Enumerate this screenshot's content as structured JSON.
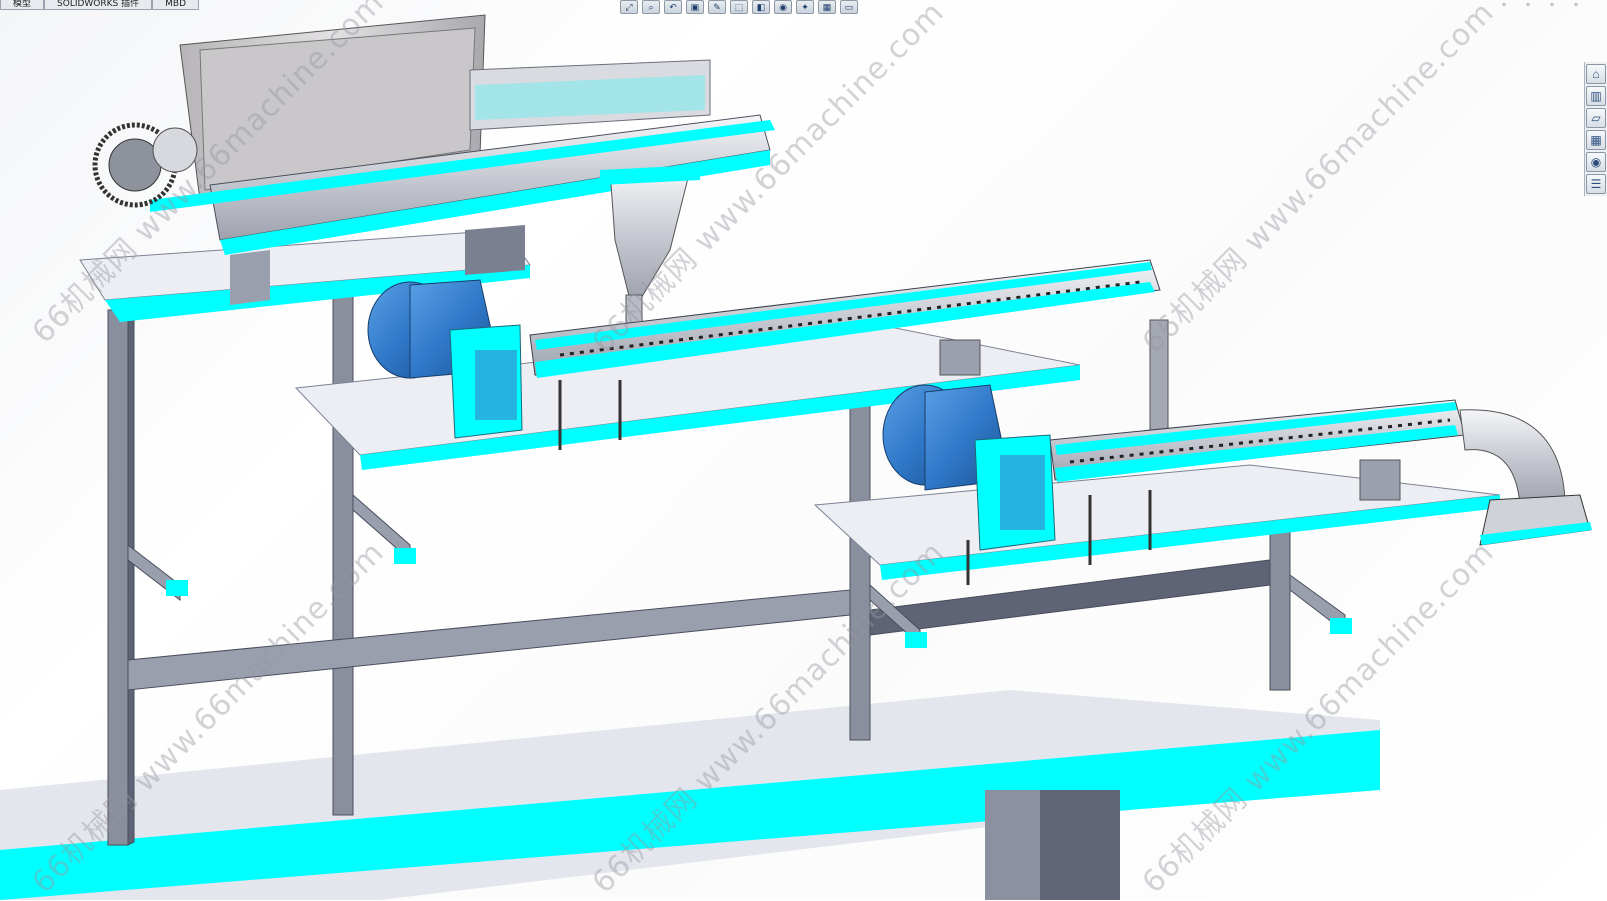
{
  "doc_tabs": [
    "模型",
    "SOLIDWORKS 插件",
    "MBD"
  ],
  "heads_up_toolbar": {
    "icons": [
      "zoom-to-fit-icon",
      "zoom-area-icon",
      "previous-view-icon",
      "section-view-icon",
      "dynamic-annotation-icon",
      "view-orientation-icon",
      "display-style-icon",
      "hide-show-icon",
      "edit-appearance-icon",
      "apply-scene-icon",
      "view-settings-icon"
    ],
    "glyphs": [
      "⤢",
      "⌕",
      "↶",
      "▣",
      "✎",
      "⬚",
      "◧",
      "◉",
      "✦",
      "▦",
      "▭"
    ]
  },
  "window_controls": {
    "icons": [
      "minimize-icon",
      "restore-icon",
      "close-icon",
      "maximize-icon"
    ],
    "glyphs": [
      "▫",
      "▫",
      "▫",
      "▫"
    ]
  },
  "task_pane": {
    "icons": [
      "home-icon",
      "3d-parts-library-icon",
      "file-explorer-icon",
      "view-palette-icon",
      "appearances-icon",
      "custom-properties-icon"
    ],
    "glyphs": [
      "⌂",
      "▥",
      "▱",
      "▦",
      "◉",
      "☰"
    ]
  },
  "watermarks": [
    "66机械网 www.66machine.com",
    "66机械网 www.66machine.com",
    "66机械网 www.66machine.com",
    "66机械网 www.66machine.com",
    "66机械网 www.66machine.com",
    "66机械网 www.66machine.com"
  ],
  "colors": {
    "accent": "#00ffff",
    "frame": "#8a8f9e",
    "frame_dark": "#5e6375",
    "panel": "#eceef4",
    "motor": "#2f78c8",
    "metal": "#c9ccd3",
    "hopper": "#d8d6d8"
  }
}
